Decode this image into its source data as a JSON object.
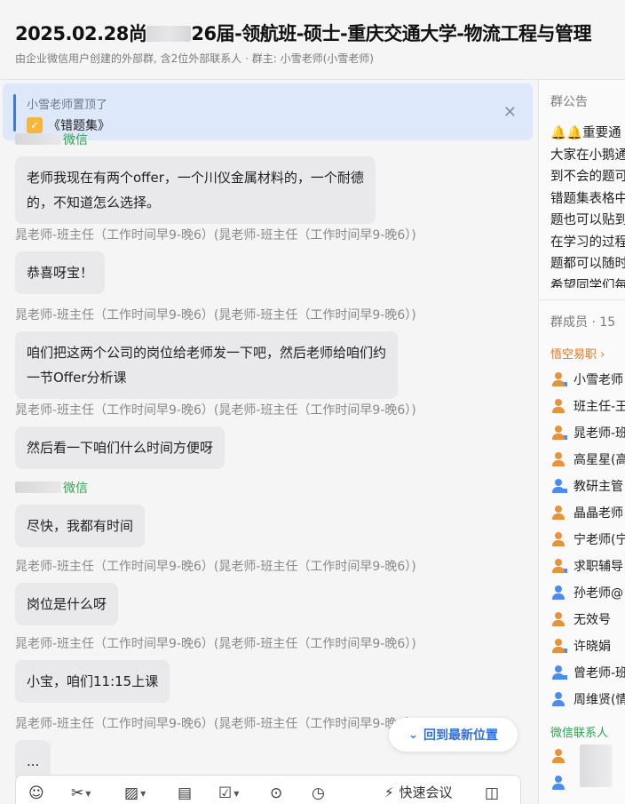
{
  "header": {
    "title_prefix": "2025.02.28尚",
    "title_suffix": "26届-领航班-硕士-重庆交通大学-物流工程与管理",
    "subtitle": "由企业微信用户创建的外部群, 含2位外部联系人 · 群主: 小雪老师(小雪老师)"
  },
  "pinned": {
    "who": "小雪老师置顶了",
    "doc": "《错题集》"
  },
  "messages": [
    {
      "sender": "微信",
      "external": true,
      "text_lines": [
        "老师我现在有两个offer，一个川仪金属材料的，一个耐德",
        "的，不知道怎么选择。"
      ]
    },
    {
      "sender": "晁老师-班主任（工作时间早9-晚6）(晁老师-班主任（工作时间早9-晚6）)",
      "external": false,
      "text_lines": [
        "恭喜呀宝！"
      ]
    },
    {
      "sender": "晁老师-班主任（工作时间早9-晚6）(晁老师-班主任（工作时间早9-晚6）)",
      "external": false,
      "text_lines": [
        "咱们把这两个公司的岗位给老师发一下吧，然后老师给咱们约",
        "一节Offer分析课"
      ]
    },
    {
      "sender": "晁老师-班主任（工作时间早9-晚6）(晁老师-班主任（工作时间早9-晚6）)",
      "external": false,
      "text_lines": [
        "然后看一下咱们什么时间方便呀"
      ]
    },
    {
      "sender": "微信",
      "external": true,
      "text_lines": [
        "尽快，我都有时间"
      ]
    },
    {
      "sender": "晁老师-班主任（工作时间早9-晚6）(晁老师-班主任（工作时间早9-晚6）)",
      "external": false,
      "text_lines": [
        "岗位是什么呀"
      ]
    },
    {
      "sender": "晁老师-班主任（工作时间早9-晚6）(晁老师-班主任（工作时间早9-晚6）)",
      "external": false,
      "text_lines": [
        "小宝，咱们11:15上课"
      ]
    },
    {
      "sender": "晁老师-班主任（工作时间早9-晚6）(晁老师-班主任（工作时间早9-晚6）)",
      "external": false,
      "text_lines": [
        "..."
      ]
    }
  ],
  "jump_button": "回到最新位置",
  "toolbar": {
    "icons": [
      "emoji-icon",
      "scissors-icon",
      "image-icon",
      "doc-icon",
      "calendar-icon",
      "more-icon",
      "schedule-icon",
      "split-icon"
    ],
    "quick_meeting": "快速会议"
  },
  "side": {
    "notice_title": "群公告",
    "notice_lines": [
      "🔔🔔重要通",
      "大家在小鹅通",
      "到不会的题可",
      "错题集表格中",
      "题也可以贴到",
      "在学习的过程",
      "题都可以随时",
      "希望同学们每"
    ],
    "members_title": "群成员 · 15",
    "group_org": "悟空易职 ›",
    "members": [
      {
        "name": "小雪老师",
        "color": "#e8923a",
        "dot": true
      },
      {
        "name": "班主任-王",
        "color": "#e8923a",
        "dot": false
      },
      {
        "name": "晁老师-班",
        "color": "#e8923a",
        "dot": true
      },
      {
        "name": "高星星(高",
        "color": "#e8923a",
        "dot": false
      },
      {
        "name": "教研主管",
        "color": "#4a8cf0",
        "dot": true
      },
      {
        "name": "晶晶老师",
        "color": "#e8923a",
        "dot": false
      },
      {
        "name": "宁老师(宁",
        "color": "#e8923a",
        "dot": false
      },
      {
        "name": "求职辅导",
        "color": "#e8923a",
        "dot": true
      },
      {
        "name": "孙老师@",
        "color": "#4a8cf0",
        "dot": false
      },
      {
        "name": "无效号",
        "color": "#e8923a",
        "dot": false
      },
      {
        "name": "许晓娟",
        "color": "#e8923a",
        "dot": true
      },
      {
        "name": "曾老师-班",
        "color": "#4a8cf0",
        "dot": true
      },
      {
        "name": "周维贤(情",
        "color": "#4a8cf0",
        "dot": false
      }
    ],
    "group_wechat": "微信联系人",
    "wechat_members": [
      {
        "name": "",
        "color": "#e8923a"
      },
      {
        "name": "",
        "color": "#4a8cf0"
      }
    ]
  }
}
